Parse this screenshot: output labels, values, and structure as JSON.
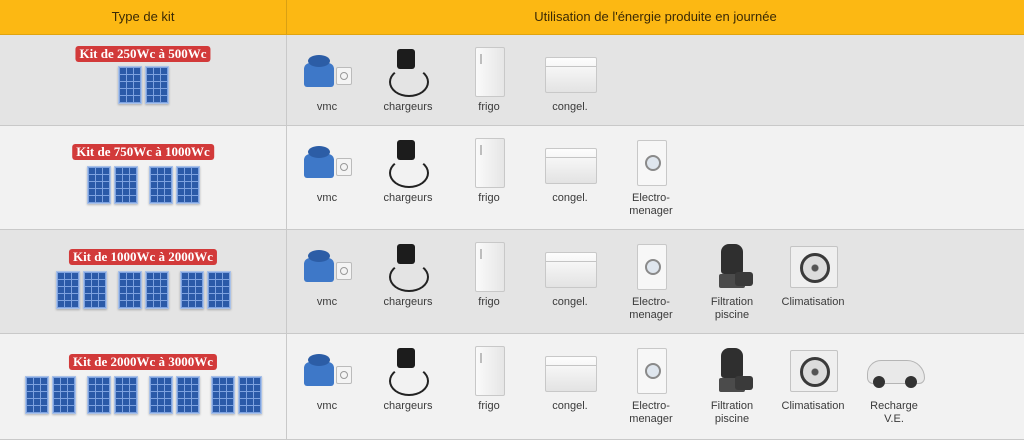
{
  "header": {
    "col_kit": "Type de kit",
    "col_usage": "Utilisation de l'énergie produite en journée"
  },
  "colors": {
    "header_bg": "#fcb813",
    "badge_bg": "#d23a3a",
    "row_grey": "#e4e4e4",
    "row_light": "#f2f2f2",
    "panel_blue": "#2b5aa8"
  },
  "labels": {
    "vmc": "vmc",
    "chargeurs": "chargeurs",
    "frigo": "frigo",
    "congel": "congel.",
    "electro_1": "Electro-",
    "electro_2": "menager",
    "filtration_1": "Filtration",
    "filtration_2": "piscine",
    "climatisation": "Climatisation",
    "recharge_1": "Recharge",
    "recharge_2": "V.E."
  },
  "rows": [
    {
      "kit": "Kit de 250Wc à 500Wc",
      "panel_count": 2
    },
    {
      "kit": "Kit de 750Wc à 1000Wc",
      "panel_count": 4
    },
    {
      "kit": "Kit de 1000Wc à 2000Wc",
      "panel_count": 6
    },
    {
      "kit": "Kit de 2000Wc à 3000Wc",
      "panel_count": 8
    }
  ],
  "icons": {
    "vmc": "ventilation-unit-icon",
    "chargeurs": "charger-icon",
    "frigo": "fridge-icon",
    "congel": "freezer-icon",
    "electro": "washing-machine-icon",
    "filtration": "pool-filter-icon",
    "climatisation": "air-conditioner-icon",
    "recharge": "electric-car-icon"
  }
}
